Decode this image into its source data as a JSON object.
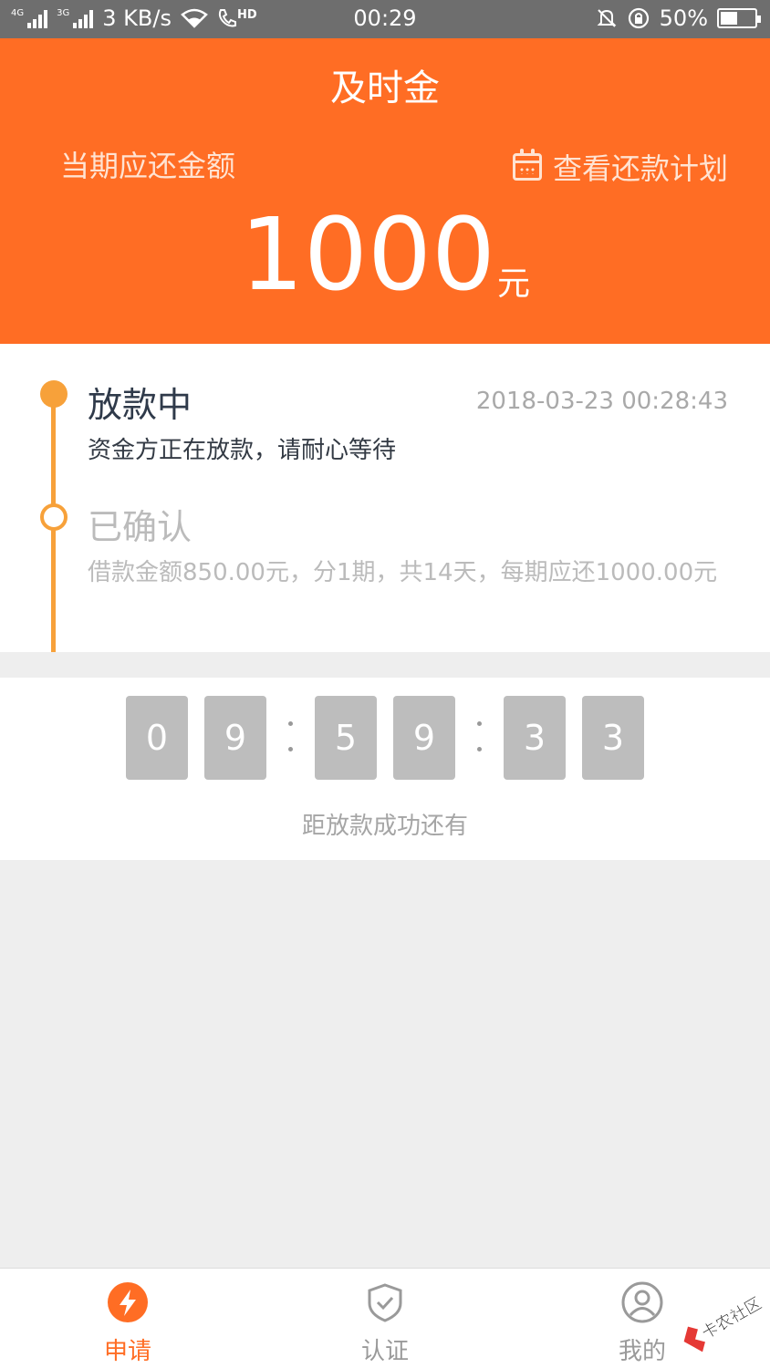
{
  "status_bar": {
    "net1": "4G",
    "net2": "3G",
    "speed": "3 KB/s",
    "hd": "HD",
    "time": "00:29",
    "battery": "50%",
    "battery_level": 0.5
  },
  "header": {
    "title": "及时金",
    "due_label": "当期应还金额",
    "plan_link": "查看还款计划",
    "amount": "1000",
    "amount_unit": "元"
  },
  "timeline": {
    "steps": [
      {
        "title": "放款中",
        "time": "2018-03-23 00:28:43",
        "desc": "资金方正在放款，请耐心等待"
      },
      {
        "title": "已确认",
        "desc": "借款金额850.00元，分1期，共14天，每期应还1000.00元"
      }
    ]
  },
  "countdown": {
    "digits": [
      "0",
      "9",
      "5",
      "9",
      "3",
      "3"
    ],
    "label": "距放款成功还有"
  },
  "nav": {
    "items": [
      {
        "label": "申请"
      },
      {
        "label": "认证"
      },
      {
        "label": "我的"
      }
    ]
  },
  "watermark": {
    "text": "卡农社区"
  },
  "colors": {
    "brand": "#ff6d24",
    "timeline": "#f7a13a",
    "digit_bg": "#bdbdbd"
  }
}
